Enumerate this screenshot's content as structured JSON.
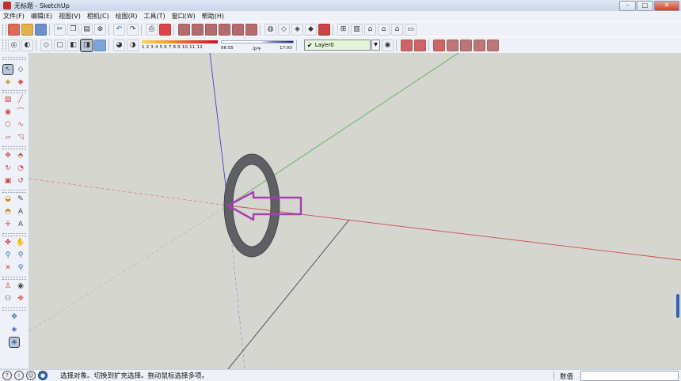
{
  "window": {
    "title": "无标题 - SketchUp",
    "controls": [
      "minimize",
      "maximize",
      "close"
    ]
  },
  "menu": {
    "items": [
      "文件(F)",
      "编辑(E)",
      "视图(V)",
      "相机(C)",
      "绘图(R)",
      "工具(T)",
      "窗口(W)",
      "帮助(H)"
    ]
  },
  "toolbar_row1": {
    "tools": [
      "new-file",
      "open-file",
      "save-file",
      "cut",
      "copy",
      "paste",
      "erase",
      "undo",
      "redo",
      "print",
      "model-info",
      "iso-view",
      "top-view",
      "front-view",
      "right-view",
      "back-view",
      "left-view",
      "x-ray",
      "wireframe",
      "hidden-line",
      "shaded",
      "shaded-texture",
      "monochrome",
      "get-models",
      "share-model",
      "component",
      "warehouse",
      "house",
      "layers"
    ]
  },
  "toolbar_row2": {
    "shadow_numbers": "1 2 3 4 5 6 7 8 9 10 11 12",
    "time_start": "06:55",
    "time_mid": "中午",
    "time_end": "17:00",
    "layer": {
      "current": "Layer0"
    }
  },
  "left_toolbar": {
    "tools": [
      "select-icon",
      "component-icon",
      "paint-bucket-icon",
      "eraser-icon",
      "rectangle-icon",
      "line-icon",
      "circle-icon",
      "arc-icon",
      "polygon-icon",
      "freehand-icon",
      "move-icon",
      "push-pull-icon",
      "rotate-icon",
      "follow-me-icon",
      "scale-icon",
      "offset-icon",
      "tape-measure-icon",
      "dimension-icon",
      "protractor-icon",
      "text-icon",
      "axes-icon",
      "3d-text-icon",
      "orbit-icon",
      "pan-icon",
      "zoom-icon",
      "zoom-window-icon",
      "zoom-extents-icon",
      "previous-view-icon",
      "position-camera-icon",
      "look-around-icon",
      "walk-icon",
      "section-plane-icon",
      "sandbox-icon",
      "sandbox2-icon",
      "sandbox3-icon"
    ]
  },
  "viewport": {
    "background": "#d6d6d1",
    "axis_colors": {
      "red": "#cf4a44",
      "green": "#5fb25a",
      "blue": "#3a46c8"
    },
    "ring_color": "#5e6066",
    "arrow_color": "#a640b3"
  },
  "status": {
    "message": "选择对象。切换到扩充选择。拖动鼠标选择多项。",
    "measure_label": "数值",
    "measure_value": ""
  }
}
